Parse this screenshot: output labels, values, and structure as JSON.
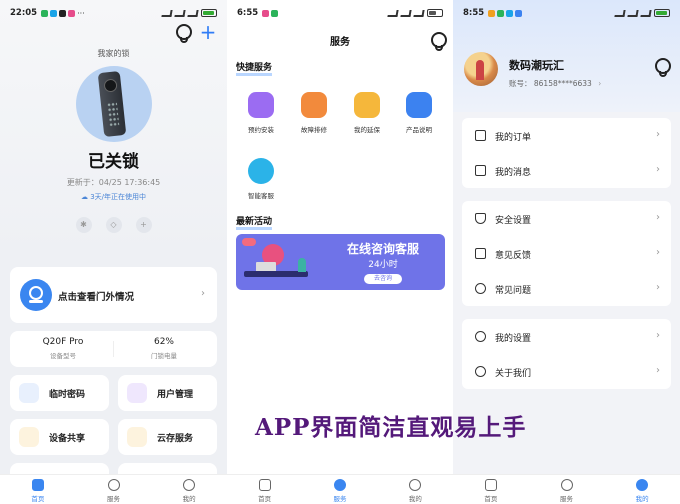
{
  "panel1": {
    "status": {
      "time": "22:05",
      "battery_text": "97"
    },
    "header": {
      "caption": "我家的锁"
    },
    "lock": {
      "status": "已关锁",
      "updated": "更新于：04/25 17:36:45",
      "storage": "3天/年正在使用中"
    },
    "door_card": {
      "label": "点击查看门外情况"
    },
    "info": {
      "model_value": "Q20F Pro",
      "model_label": "设备型号",
      "battery_value": "62%",
      "battery_label": "门锁电量"
    },
    "tiles": [
      {
        "label": "临时密码",
        "icon": "keypad-icon",
        "color": "#e8f0fd"
      },
      {
        "label": "用户管理",
        "icon": "user-icon",
        "color": "#efe7fd"
      },
      {
        "label": "设备共享",
        "icon": "share-user-icon",
        "color": "#fdf3de"
      },
      {
        "label": "云存服务",
        "icon": "cloud-icon",
        "color": "#fdf3de"
      }
    ],
    "tabs": [
      {
        "label": "首页",
        "active": true
      },
      {
        "label": "服务",
        "active": false
      },
      {
        "label": "我的",
        "active": false
      }
    ]
  },
  "panel2": {
    "status": {
      "time": "6:55",
      "battery_text": "63"
    },
    "title": "服务",
    "quick_title": "快捷服务",
    "services": [
      {
        "label": "预约安装",
        "icon": "install-plus-icon",
        "color": "#9b6cf2"
      },
      {
        "label": "故障排修",
        "icon": "wrench-icon",
        "color": "#f28a3c"
      },
      {
        "label": "我的延保",
        "icon": "warranty-star-icon",
        "color": "#f5b73b"
      },
      {
        "label": "产品说明",
        "icon": "manual-icon",
        "color": "#3c82f0"
      },
      {
        "label": "智能客服",
        "icon": "support-headset-icon",
        "color": "#2bb3e8"
      }
    ],
    "activity_title": "最新活动",
    "banner": {
      "title": "在线咨询客服",
      "subtitle": "24小时",
      "button": "去咨询"
    },
    "tabs": [
      {
        "label": "首页",
        "active": false
      },
      {
        "label": "服务",
        "active": true
      },
      {
        "label": "我的",
        "active": false
      }
    ]
  },
  "panel3": {
    "status": {
      "time": "8:55",
      "battery_text": "97"
    },
    "user": {
      "name": "数码潮玩汇",
      "account": "账号： 86158****6633"
    },
    "groups": [
      [
        {
          "label": "我的订单",
          "icon": "order-icon"
        },
        {
          "label": "我的消息",
          "icon": "message-icon"
        }
      ],
      [
        {
          "label": "安全设置",
          "icon": "shield-icon"
        },
        {
          "label": "意见反馈",
          "icon": "feedback-icon"
        },
        {
          "label": "常见问题",
          "icon": "question-icon"
        }
      ],
      [
        {
          "label": "我的设置",
          "icon": "settings-icon"
        },
        {
          "label": "关于我们",
          "icon": "info-icon"
        }
      ]
    ],
    "tabs": [
      {
        "label": "首页",
        "active": false
      },
      {
        "label": "服务",
        "active": false
      },
      {
        "label": "我的",
        "active": true
      }
    ]
  },
  "overlay_caption": "APP界面简洁直观易上手"
}
